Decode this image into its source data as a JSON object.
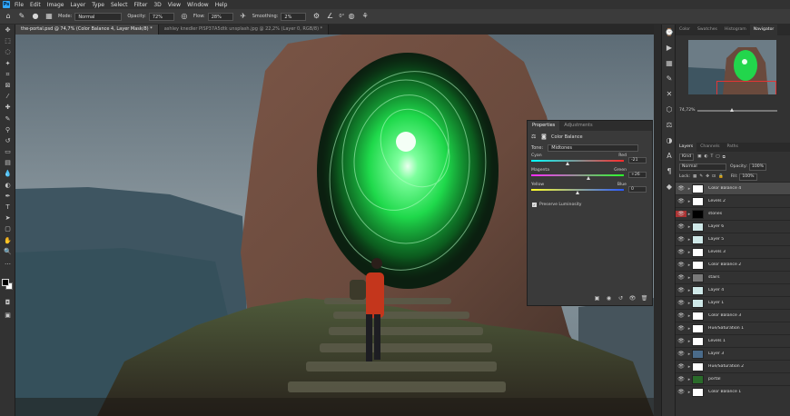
{
  "menu": [
    "File",
    "Edit",
    "Image",
    "Layer",
    "Type",
    "Select",
    "Filter",
    "3D",
    "View",
    "Window",
    "Help"
  ],
  "options": {
    "mode_label": "Mode:",
    "mode_value": "Normal",
    "opacity_label": "Opacity:",
    "opacity_value": "72%",
    "flow_label": "Flow:",
    "flow_value": "28%",
    "smoothing_label": "Smoothing:",
    "smoothing_value": "2%",
    "angle_value": "0°"
  },
  "tabs": [
    {
      "label": "the-portal.psd @ 74,7% (Color Balance 4, Layer Mask/8) *",
      "active": true
    },
    {
      "label": "ashley knedler PISP37A5dtk unsplash.jpg @ 22,2% (Layer 0, RGB/8) *",
      "active": false
    }
  ],
  "properties": {
    "tab_active": "Properties",
    "tab_other": "Adjustments",
    "adjustment_name": "Color Balance",
    "tone_label": "Tone:",
    "tone_value": "Midtones",
    "sliders": [
      {
        "left": "Cyan",
        "right": "Red",
        "value": "-21",
        "pos": 0.4,
        "colors": [
          "#00ffff",
          "#ff2a2a"
        ]
      },
      {
        "left": "Magenta",
        "right": "Green",
        "value": "+26",
        "pos": 0.62,
        "colors": [
          "#ff2aff",
          "#2aff2a"
        ]
      },
      {
        "left": "Yellow",
        "right": "Blue",
        "value": "0",
        "pos": 0.5,
        "colors": [
          "#ffff2a",
          "#2a5aff"
        ]
      }
    ],
    "preserve_label": "Preserve Luminosity"
  },
  "navigator": {
    "tabs": [
      "Color",
      "Swatches",
      "Histogram",
      "Navigator"
    ],
    "active": "Navigator",
    "zoom": "74,72%"
  },
  "layers": {
    "tabs": [
      "Layers",
      "Channels",
      "Paths"
    ],
    "kind_label": "Kind",
    "blend_mode": "Normal",
    "opacity_label": "Opacity:",
    "opacity_value": "100%",
    "lock_label": "Lock:",
    "fill_label": "Fill:",
    "fill_value": "100%",
    "items": [
      {
        "name": "Color Balance 4",
        "visible": true,
        "selected": true,
        "thumb": "#ffffff"
      },
      {
        "name": "Levels 2",
        "visible": true,
        "selected": false,
        "thumb": "#ffffff"
      },
      {
        "name": "stones",
        "visible": true,
        "selected": false,
        "thumb": "#000000",
        "hidden_state": true
      },
      {
        "name": "Layer 6",
        "visible": true,
        "selected": false,
        "thumb": "#cfe8e8"
      },
      {
        "name": "Layer 5",
        "visible": true,
        "selected": false,
        "thumb": "#cfe8e8"
      },
      {
        "name": "Levels 3",
        "visible": true,
        "selected": false,
        "thumb": "#ffffff"
      },
      {
        "name": "Color Balance 2",
        "visible": true,
        "selected": false,
        "thumb": "#ffffff"
      },
      {
        "name": "stairs",
        "visible": true,
        "selected": false,
        "thumb": "#7a7a7a"
      },
      {
        "name": "Layer 4",
        "visible": true,
        "selected": false,
        "thumb": "#cfe8e8"
      },
      {
        "name": "Layer 1",
        "visible": true,
        "selected": false,
        "thumb": "#cfe8e8"
      },
      {
        "name": "Color Balance 3",
        "visible": true,
        "selected": false,
        "thumb": "#ffffff"
      },
      {
        "name": "Hue/Saturation 1",
        "visible": true,
        "selected": false,
        "thumb": "#ffffff"
      },
      {
        "name": "Levels 1",
        "visible": true,
        "selected": false,
        "thumb": "#ffffff"
      },
      {
        "name": "Layer 3",
        "visible": true,
        "selected": false,
        "thumb": "#4a6b8a"
      },
      {
        "name": "Hue/Saturation 2",
        "visible": true,
        "selected": false,
        "thumb": "#ffffff"
      },
      {
        "name": "portal",
        "visible": true,
        "selected": false,
        "thumb": "#2a6b2a"
      },
      {
        "name": "Color Balance 1",
        "visible": true,
        "selected": false,
        "thumb": "#ffffff"
      }
    ]
  },
  "colors": {
    "accent_selection": "#e23535",
    "portal_green": "#2bff5a",
    "panel_bg": "#323232"
  }
}
